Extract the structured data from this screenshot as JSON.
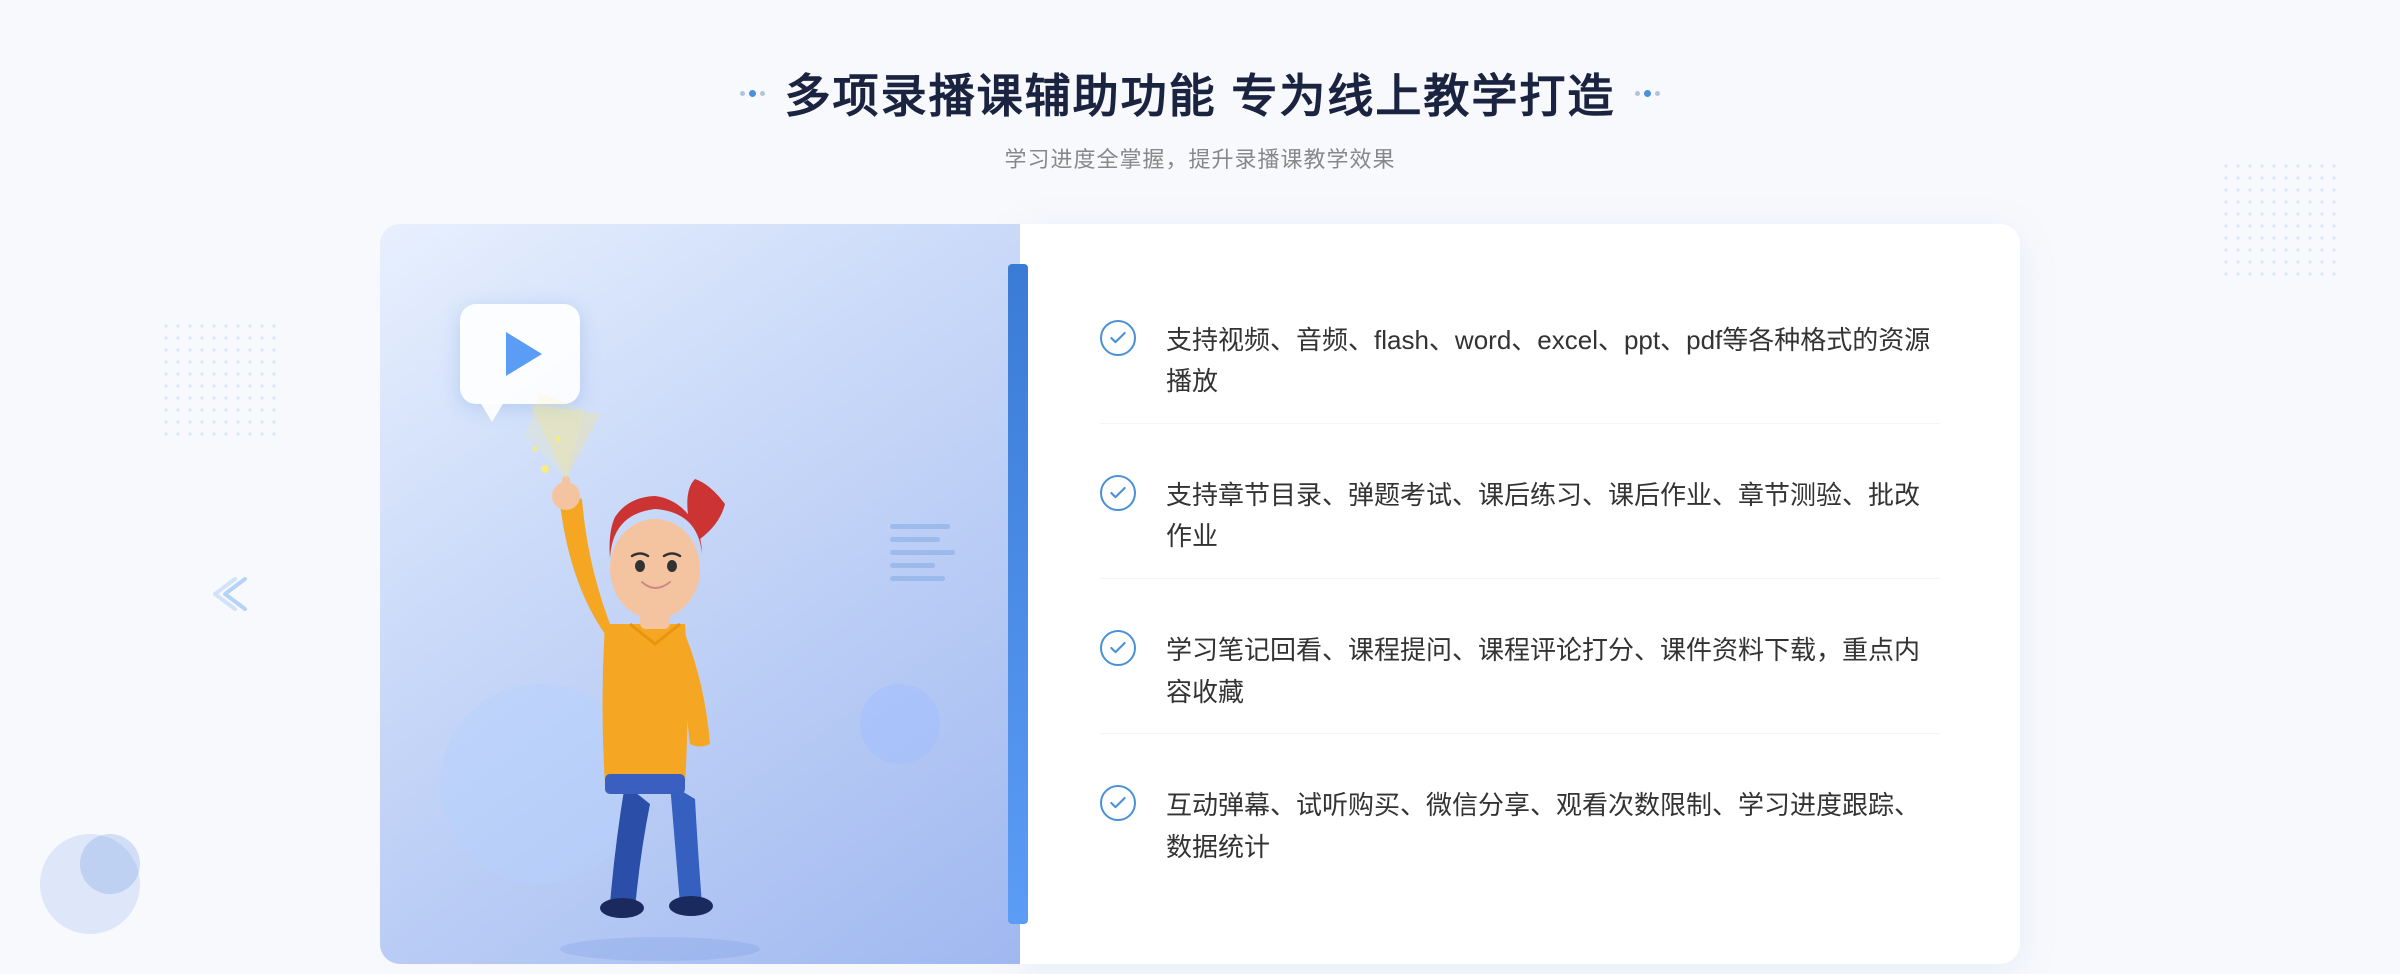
{
  "header": {
    "title": "多项录播课辅助功能 专为线上教学打造",
    "subtitle": "学习进度全掌握，提升录播课教学效果"
  },
  "decoration": {
    "left_dots_label": "decoration-dots-left",
    "right_dots_label": "decoration-dots-right"
  },
  "features": [
    {
      "id": 1,
      "text": "支持视频、音频、flash、word、excel、ppt、pdf等各种格式的资源播放"
    },
    {
      "id": 2,
      "text": "支持章节目录、弹题考试、课后练习、课后作业、章节测验、批改作业"
    },
    {
      "id": 3,
      "text": "学习笔记回看、课程提问、课程评论打分、课件资料下载，重点内容收藏"
    },
    {
      "id": 4,
      "text": "互动弹幕、试听购买、微信分享、观看次数限制、学习进度跟踪、数据统计"
    }
  ],
  "colors": {
    "primary_blue": "#4a90d9",
    "accent_blue": "#5b9cf6",
    "dark_blue": "#3a7bd5",
    "text_dark": "#1a2340",
    "text_gray": "#888888",
    "text_body": "#333333",
    "bg_light": "#f8f9fc",
    "panel_bg": "#ffffff"
  }
}
